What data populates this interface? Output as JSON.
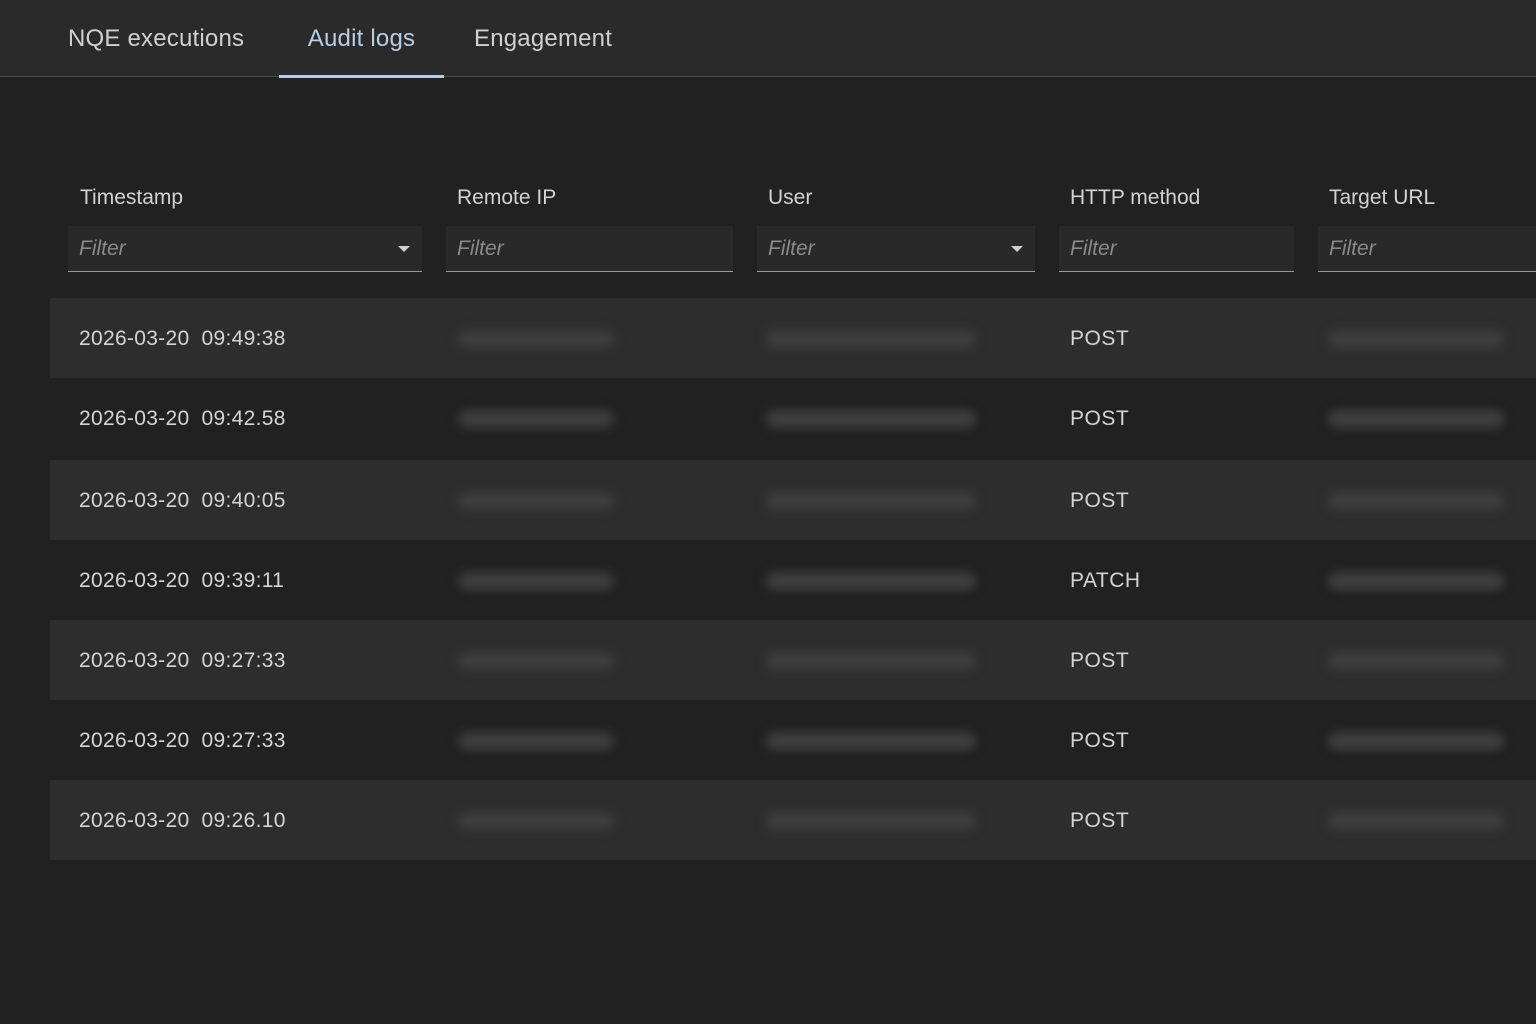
{
  "tabs": [
    {
      "label": "NQE executions",
      "active": false
    },
    {
      "label": "Audit logs",
      "active": true
    },
    {
      "label": "Engagement",
      "active": false
    }
  ],
  "table": {
    "columns": [
      {
        "label": "Timestamp",
        "filter_placeholder": "Filter",
        "has_dropdown": true
      },
      {
        "label": "Remote IP",
        "filter_placeholder": "Filter",
        "has_dropdown": false
      },
      {
        "label": "User",
        "filter_placeholder": "Filter",
        "has_dropdown": true
      },
      {
        "label": "HTTP method",
        "filter_placeholder": "Filter",
        "has_dropdown": false
      },
      {
        "label": "Target URL",
        "filter_placeholder": "Filter",
        "has_dropdown": false
      }
    ],
    "rows": [
      {
        "timestamp": "2026-03-20 09:49:38",
        "http_method": "POST"
      },
      {
        "timestamp": "2026-03-20 09:42.58",
        "http_method": "POST"
      },
      {
        "timestamp": "2026-03-20 09:40:05",
        "http_method": "POST"
      },
      {
        "timestamp": "2026-03-20 09:39:11",
        "http_method": "PATCH"
      },
      {
        "timestamp": "2026-03-20 09:27:33",
        "http_method": "POST"
      },
      {
        "timestamp": "2026-03-20 09:27:33",
        "http_method": "POST"
      },
      {
        "timestamp": "2026-03-20 09:26.10",
        "http_method": "POST"
      }
    ]
  },
  "colors": {
    "background": "#212121",
    "tabbar": "#2a2a2a",
    "row_alt": "#2d2d2d",
    "accent": "#b9cde6"
  }
}
